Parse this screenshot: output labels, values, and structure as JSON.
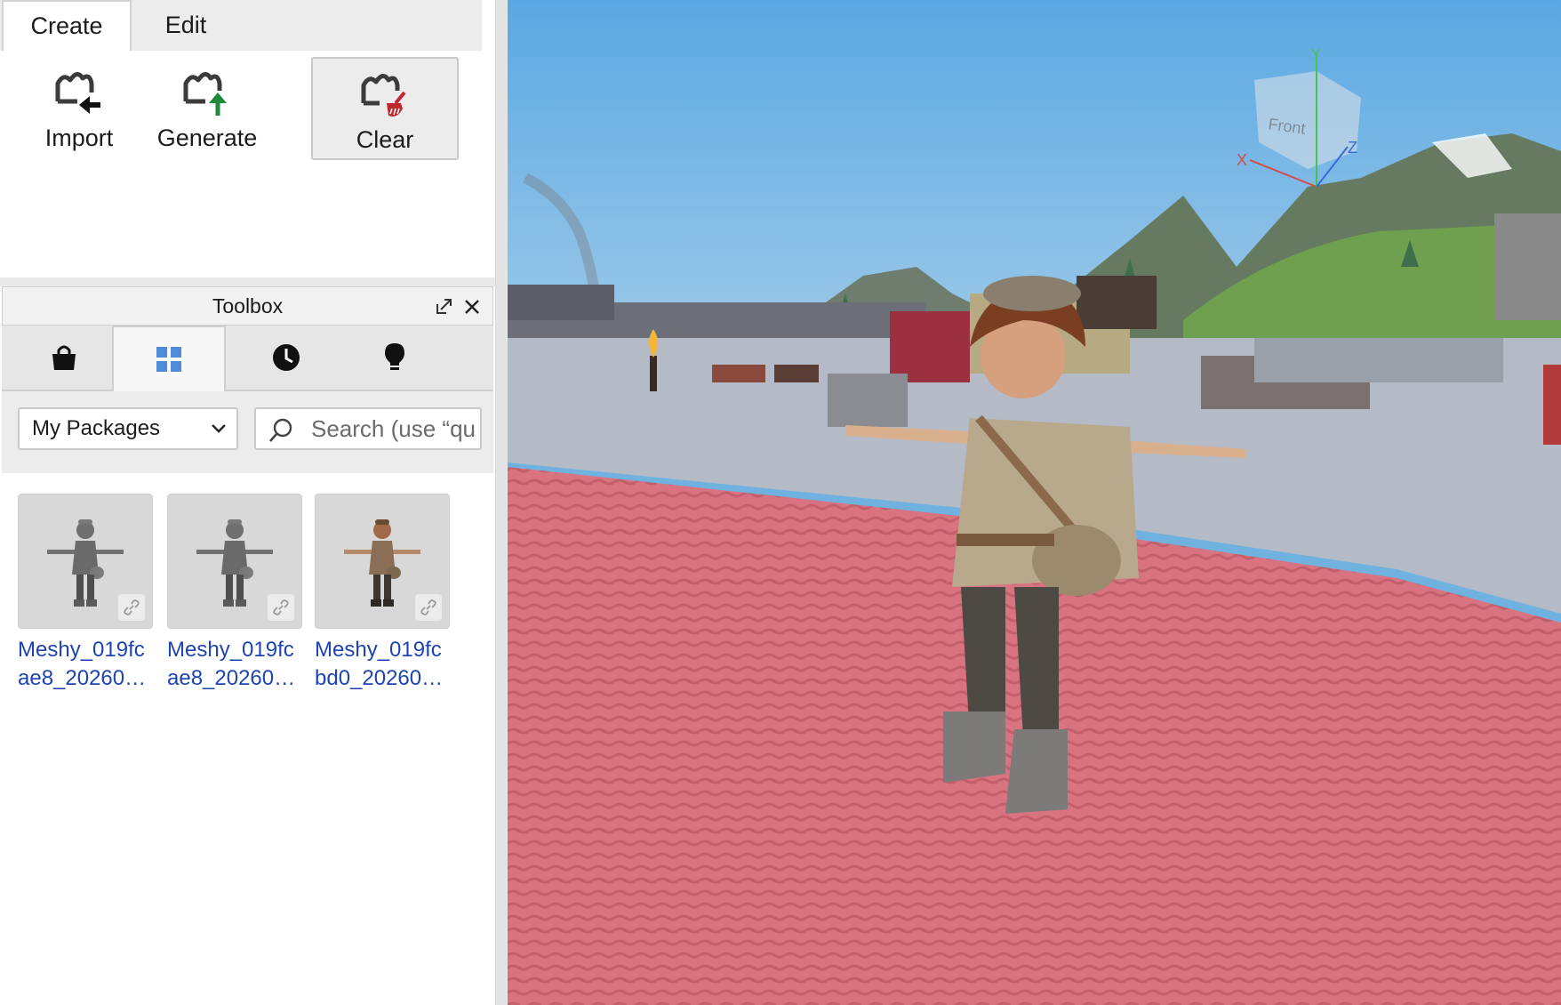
{
  "plugin": {
    "tabs": [
      "Create",
      "Edit"
    ],
    "tools": [
      {
        "label": "Import",
        "icon": "import-mesh-icon"
      },
      {
        "label": "Generate",
        "icon": "generate-mesh-icon"
      },
      {
        "label": "Clear",
        "icon": "clear-mesh-icon"
      }
    ]
  },
  "toolbox": {
    "title": "Toolbox",
    "tabs": [
      "marketplace-bag-icon",
      "inventory-grid-icon",
      "recent-clock-icon",
      "creations-bulb-icon"
    ],
    "dropdown": {
      "selected": "My Packages"
    },
    "search": {
      "placeholder": "Search (use “qu"
    },
    "items": [
      {
        "name": "Meshy_019fcae8_20260…"
      },
      {
        "name": "Meshy_019fcae8_20260…"
      },
      {
        "name": "Meshy_019fcbd0_20260…"
      }
    ]
  },
  "viewport": {
    "view_cube": {
      "face": "Front",
      "axes": [
        "X",
        "Y",
        "Z"
      ]
    }
  },
  "colors": {
    "accent": "#4f8bd6",
    "link": "#1e44b2",
    "ground": "#d9737f",
    "sky": "#6fb2e0"
  }
}
